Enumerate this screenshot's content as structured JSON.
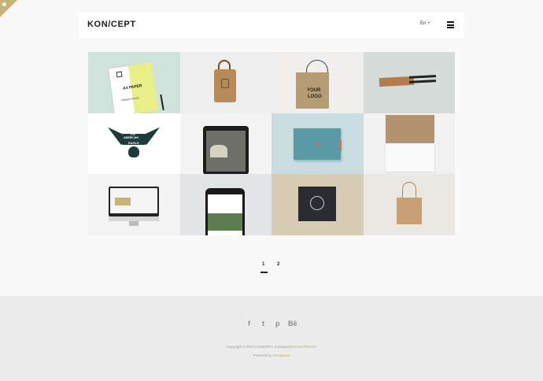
{
  "brand": {
    "logo": "KON/CEPT"
  },
  "header": {
    "language": "En"
  },
  "portfolio": {
    "items": [
      {
        "name": "a4-paper-mockup",
        "bg": "#cfe2dc"
      },
      {
        "name": "leather-bag-mockup",
        "bg": "#eeeeee"
      },
      {
        "name": "shopping-bag-logo-mockup",
        "bg": "#f0efed"
      },
      {
        "name": "pen-case-mockup",
        "bg": "#d5dcda"
      },
      {
        "name": "american-eagle-logo",
        "bg": "#ffffff"
      },
      {
        "name": "tablet-mockup",
        "bg": "#f4f4f4"
      },
      {
        "name": "notebook-mockup",
        "bg": "#c9dde0"
      },
      {
        "name": "envelope-mockup",
        "bg": "#f1f1f1"
      },
      {
        "name": "imac-mockup",
        "bg": "#f3f3f3"
      },
      {
        "name": "iphone-mockup",
        "bg": "#e2e4e8"
      },
      {
        "name": "book-cover-mockup",
        "bg": "#d8ccb4"
      },
      {
        "name": "tote-bag-mockup",
        "bg": "#ebe8e3"
      }
    ],
    "tile_text": {
      "a4_paper": "A4 PAPER",
      "presentation": "PRESENTATION",
      "your": "YOUR",
      "logo": "LOGO",
      "the": "The",
      "american": "AMERICAN",
      "eagle": "EAGLE"
    }
  },
  "pagination": {
    "pages": [
      "1",
      "2"
    ],
    "active": "1"
  },
  "footer": {
    "social": [
      "f",
      "t",
      "p",
      "Bē"
    ],
    "copyright_prefix": "Copyright © 2014 KON/CEPT. Created by ",
    "copyright_link": "KnownThemes",
    "powered_prefix": "Powered by ",
    "powered_link": "Wordpress"
  },
  "colors": {
    "accent": "#c0a46a",
    "footer_bg": "#ececec",
    "page_bg": "#f9f9f9"
  }
}
